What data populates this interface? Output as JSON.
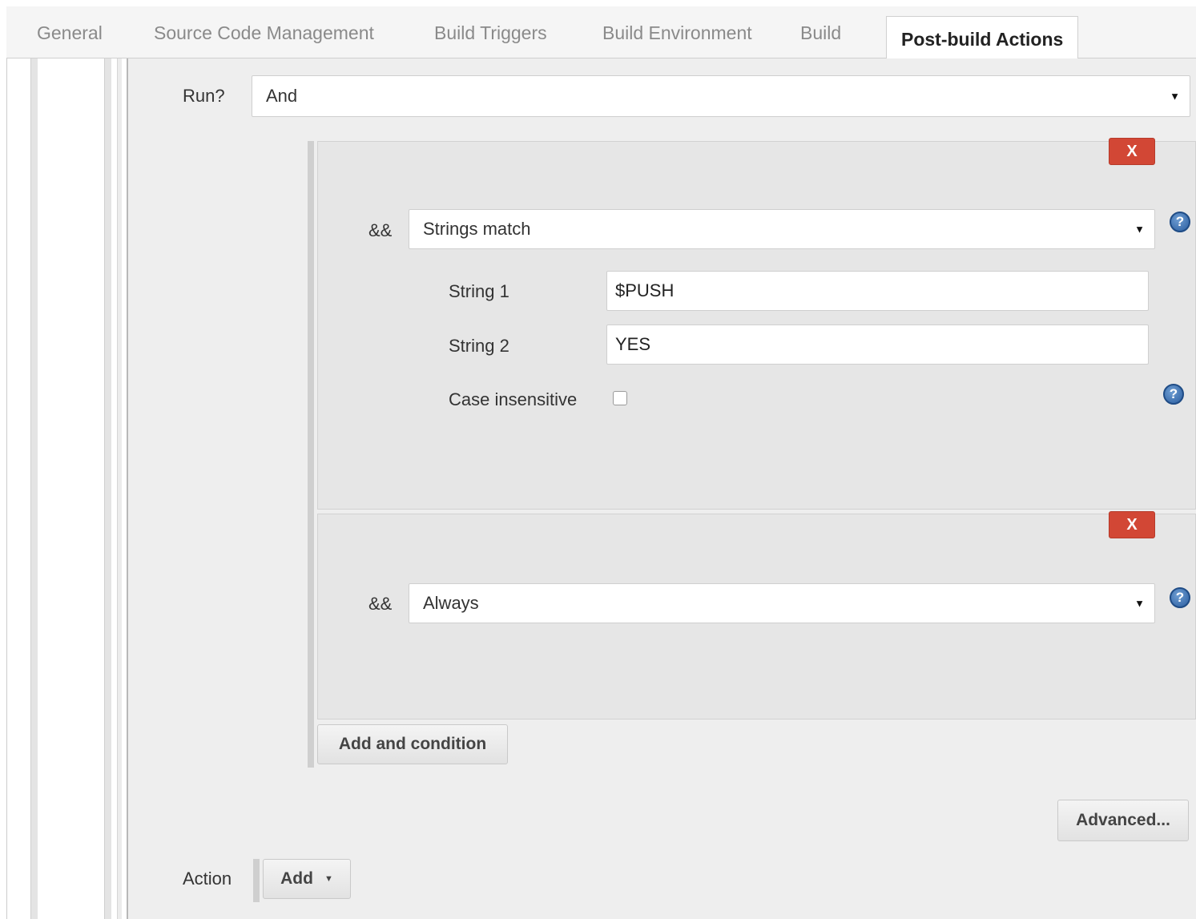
{
  "tabs": [
    {
      "label": "General"
    },
    {
      "label": "Source Code Management"
    },
    {
      "label": "Build Triggers"
    },
    {
      "label": "Build Environment"
    },
    {
      "label": "Build"
    },
    {
      "label": "Post-build Actions"
    }
  ],
  "active_tab": "Post-build Actions",
  "run": {
    "label": "Run?",
    "value": "And"
  },
  "conditions": [
    {
      "operator": "&&",
      "remove_label": "X",
      "type": "Strings match",
      "fields": {
        "string1_label": "String 1",
        "string1_value": "$PUSH",
        "string2_label": "String 2",
        "string2_value": "YES",
        "case_label": "Case insensitive",
        "case_checked": false
      }
    },
    {
      "operator": "&&",
      "remove_label": "X",
      "type": "Always"
    }
  ],
  "add_condition_label": "Add and condition",
  "advanced_label": "Advanced...",
  "action": {
    "label": "Action",
    "add_label": "Add"
  },
  "icons": {
    "help": "help-icon",
    "caret": "caret-down-icon"
  },
  "colors": {
    "remove": "#d24735",
    "panel": "#eeeeee",
    "block": "#e6e6e6"
  }
}
